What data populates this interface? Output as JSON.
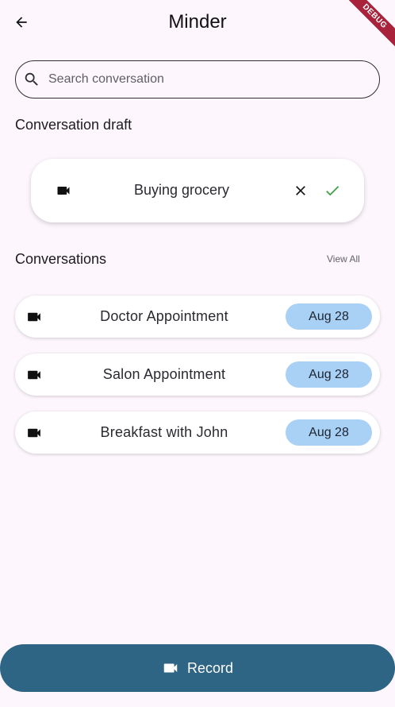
{
  "app": {
    "title": "Minder",
    "debug_banner": "DEBUG"
  },
  "search": {
    "placeholder": "Search conversation",
    "value": ""
  },
  "draft": {
    "section_title": "Conversation draft",
    "item": {
      "title": "Buying grocery",
      "icon": "video-camera-icon"
    }
  },
  "conversations": {
    "section_title": "Conversations",
    "view_all_label": "View All",
    "items": [
      {
        "title": "Doctor Appointment",
        "date": "Aug 28"
      },
      {
        "title": "Salon Appointment",
        "date": "Aug 28"
      },
      {
        "title": "Breakfast with John",
        "date": "Aug 28"
      }
    ]
  },
  "record": {
    "label": "Record"
  },
  "colors": {
    "background": "#fdf7fd",
    "date_chip": "#a9d1f6",
    "record_button": "#2f6584",
    "confirm_check": "#43a047",
    "debug_ribbon": "#a8223b"
  }
}
